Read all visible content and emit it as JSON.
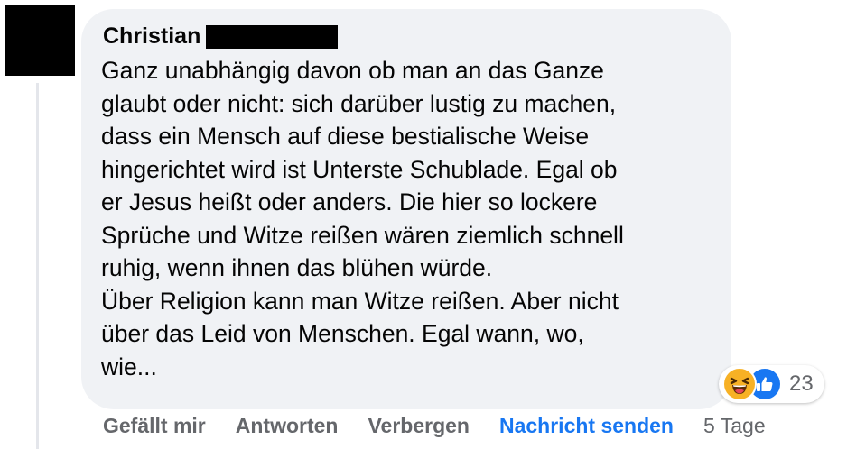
{
  "comment": {
    "author_name": "Christian",
    "text_lines": [
      "Ganz unabhängig davon ob man an das Ganze",
      "glaubt oder nicht: sich darüber lustig zu machen,",
      "dass ein Mensch auf diese bestialische Weise",
      "hingerichtet wird ist Unterste Schublade. Egal ob",
      "er Jesus heißt oder anders. Die hier so lockere",
      "Sprüche und Witze reißen wären ziemlich schnell",
      "ruhig, wenn ihnen das blühen würde.",
      "Über Religion kann man Witze reißen. Aber nicht",
      "über das Leid von Menschen. Egal wann, wo,",
      "wie..."
    ],
    "reactions": {
      "icons": [
        "haha-reaction-icon",
        "like-reaction-icon"
      ],
      "count": "23"
    }
  },
  "actions": {
    "like": "Gefällt mir",
    "reply": "Antworten",
    "hide": "Verbergen",
    "message": "Nachricht senden",
    "timestamp": "5 Tage"
  },
  "colors": {
    "bubble": "#f0f2f5",
    "action_text": "#65676b",
    "primary_link": "#1877f2",
    "like_blue": "#1877f2",
    "haha_yellow": "#f7b125"
  }
}
